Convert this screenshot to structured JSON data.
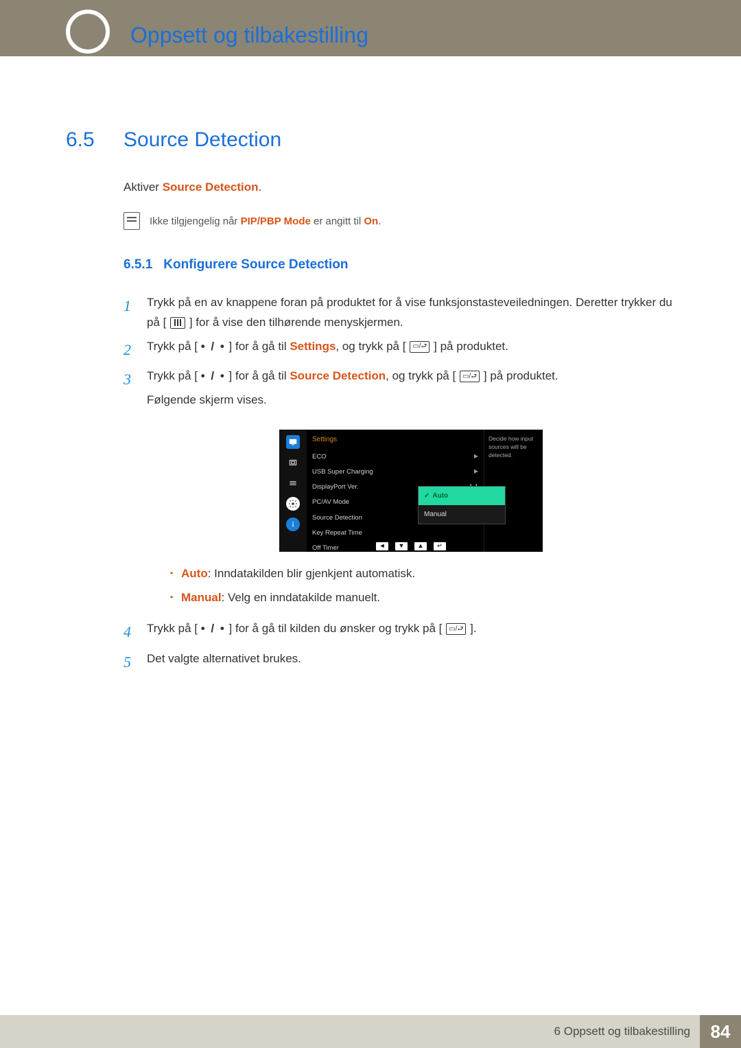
{
  "header": {
    "page_title": "Oppsett og tilbakestilling"
  },
  "section": {
    "num": "6.5",
    "title": "Source Detection"
  },
  "intro": {
    "prefix": "Aktiver ",
    "accent": "Source Detection",
    "suffix": "."
  },
  "note": {
    "prefix": "Ikke tilgjengelig når ",
    "accent1": "PIP/PBP Mode",
    "mid": " er angitt til ",
    "accent2": "On",
    "suffix": "."
  },
  "subsection": {
    "num": "6.5.1",
    "title": "Konfigurere Source Detection"
  },
  "steps": {
    "s1": {
      "num": "1",
      "a": "Trykk på en av knappene foran på produktet for å vise funksjonstasteveiledningen. Deretter trykker du på [",
      "b": "] for å vise den tilhørende menyskjermen."
    },
    "s2": {
      "num": "2",
      "a": "Trykk på [ ",
      "dots": "• / •",
      "b": " ] for å gå til ",
      "accent": "Settings",
      "c": ", og trykk på [",
      "d": "] på produktet."
    },
    "s3": {
      "num": "3",
      "a": "Trykk på [ ",
      "dots": "• / •",
      "b": " ] for å gå til ",
      "accent": "Source Detection",
      "c": ", og trykk på [",
      "d": "] på produktet.",
      "e": "Følgende skjerm vises."
    },
    "s4": {
      "num": "4",
      "a": "Trykk på [ ",
      "dots": "• / •",
      "b": " ] for å gå til kilden du ønsker og trykk på [",
      "c": "]."
    },
    "s5": {
      "num": "5",
      "a": "Det valgte alternativet brukes."
    }
  },
  "osd": {
    "title": "Settings",
    "rows": {
      "eco": "ECO",
      "usb": "USB Super Charging",
      "dp": "DisplayPort Ver.",
      "dp_val": "1.1",
      "pcav": "PC/AV Mode",
      "src": "Source Detection",
      "key": "Key Repeat Time",
      "off": "Off Timer"
    },
    "options": {
      "auto": "Auto",
      "manual": "Manual"
    },
    "side": "Decide how input sources will be detected.",
    "nav": {
      "left": "◄",
      "down": "▼",
      "up": "▲",
      "enter": "↵"
    }
  },
  "bullets": {
    "auto": {
      "label": "Auto",
      "text": ": Inndatakilden blir gjenkjent automatisk."
    },
    "manual": {
      "label": "Manual",
      "text": ": Velg en inndatakilde manuelt."
    }
  },
  "footer": {
    "text": "6 Oppsett og tilbakestilling",
    "page": "84"
  }
}
